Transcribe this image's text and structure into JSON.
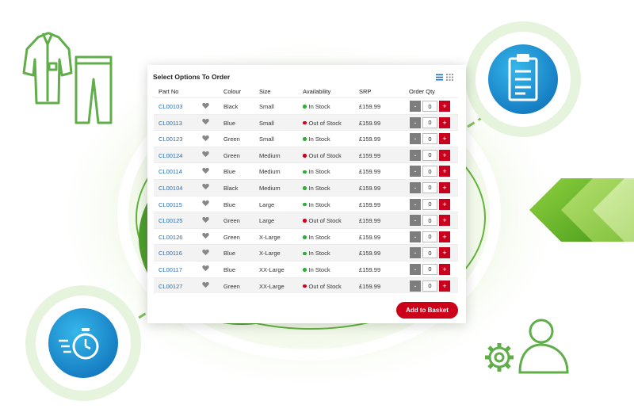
{
  "panel": {
    "title": "Select Options To Order",
    "columns": {
      "part_no": "Part No",
      "colour": "Colour",
      "size": "Size",
      "availability": "Availability",
      "srp": "SRP",
      "order_qty": "Order Qty"
    },
    "rows": [
      {
        "part": "CL00103",
        "colour": "Black",
        "size": "Small",
        "status": "in",
        "availability": "In Stock",
        "srp": "£159.99",
        "qty": "0"
      },
      {
        "part": "CL00113",
        "colour": "Blue",
        "size": "Small",
        "status": "out",
        "availability": "Out of Stock",
        "srp": "£159.99",
        "qty": "0"
      },
      {
        "part": "CL00123",
        "colour": "Green",
        "size": "Small",
        "status": "in",
        "availability": "In Stock",
        "srp": "£159.99",
        "qty": "0"
      },
      {
        "part": "CL00124",
        "colour": "Green",
        "size": "Medium",
        "status": "out",
        "availability": "Out of Stock",
        "srp": "£159.99",
        "qty": "0"
      },
      {
        "part": "CL00114",
        "colour": "Blue",
        "size": "Medium",
        "status": "in",
        "availability": "In Stock",
        "srp": "£159.99",
        "qty": "0"
      },
      {
        "part": "CL00104",
        "colour": "Black",
        "size": "Medium",
        "status": "in",
        "availability": "In Stock",
        "srp": "£159.99",
        "qty": "0"
      },
      {
        "part": "CL00115",
        "colour": "Blue",
        "size": "Large",
        "status": "in",
        "availability": "In Stock",
        "srp": "£159.99",
        "qty": "0"
      },
      {
        "part": "CL00125",
        "colour": "Green",
        "size": "Large",
        "status": "out",
        "availability": "Out of Stock",
        "srp": "£159.99",
        "qty": "0"
      },
      {
        "part": "CL00126",
        "colour": "Green",
        "size": "X-Large",
        "status": "in",
        "availability": "In Stock",
        "srp": "£159.99",
        "qty": "0"
      },
      {
        "part": "CL00116",
        "colour": "Blue",
        "size": "X-Large",
        "status": "in",
        "availability": "In Stock",
        "srp": "£159.99",
        "qty": "0"
      },
      {
        "part": "CL00117",
        "colour": "Blue",
        "size": "XX-Large",
        "status": "in",
        "availability": "In Stock",
        "srp": "£159.99",
        "qty": "0"
      },
      {
        "part": "CL00127",
        "colour": "Green",
        "size": "XX-Large",
        "status": "out",
        "availability": "Out of Stock",
        "srp": "£159.99",
        "qty": "0"
      }
    ],
    "minus_label": "-",
    "plus_label": "+",
    "add_to_basket": "Add to Basket"
  },
  "icons": {
    "view_list": "list-view-icon",
    "view_grid": "grid-view-icon",
    "favourite": "heart-icon",
    "workwear": "workwear-clothing-icon",
    "clipboard": "clipboard-icon",
    "stopwatch": "stopwatch-icon",
    "user_settings": "user-gear-icon",
    "chevrons": "chevron-arrows-icon"
  },
  "colors": {
    "accent_red": "#cc0018",
    "link_blue": "#2a6db0",
    "in_stock": "#2fae38",
    "out_of_stock": "#d0021b",
    "brand_green": "#5fae49",
    "brand_blue": "#1b8fd2"
  }
}
